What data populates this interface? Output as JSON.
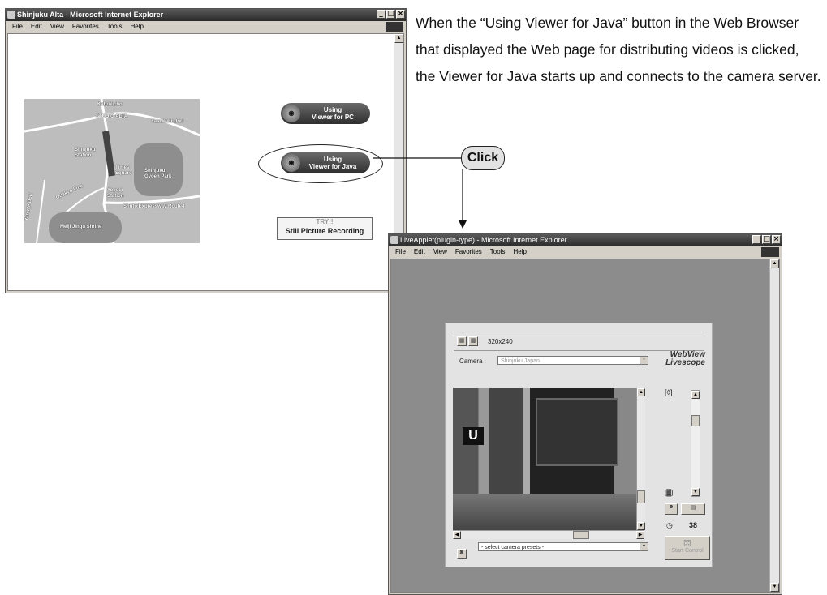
{
  "top_window": {
    "title": "Shinjuku Alta - Microsoft Internet Explorer",
    "menu": [
      "File",
      "Edit",
      "View",
      "Favorites",
      "Tools",
      "Help"
    ],
    "map_labels": {
      "kabukicho": "Kabukicho",
      "studio_alta": "STUDIO ALTA",
      "yasukuni": "Yasukuni Dori",
      "shinjuku_station": "Shinjuku Station",
      "times_square": "Times Square",
      "shinjuku_gyoen": "Shinjuku Gyoen Park",
      "odakyu": "Odakyu Line",
      "yoyogi": "Yoyogi Station",
      "yamate": "Yamate Dori",
      "shuto": "Shuto Expressway Route4",
      "meiji": "Meiji Jingu Shrine"
    },
    "btn_pc": {
      "line1": "Using",
      "line2": "Viewer for PC"
    },
    "btn_java": {
      "line1": "Using",
      "line2": "Viewer for Java"
    },
    "btn_still": {
      "badge": "TRY!!",
      "label": "Still Picture Recording"
    }
  },
  "description": "When the “Using Viewer for Java” button in the Web Browser that displayed the Web page for distributing videos is clicked, the Viewer for Java starts up and connects to the camera server.",
  "callout": "Click",
  "bottom_window": {
    "title": "LiveApplet(plugin-type) - Microsoft Internet Explorer",
    "menu": [
      "File",
      "Edit",
      "View",
      "Favorites",
      "Tools",
      "Help"
    ],
    "applet": {
      "resolution": "320x240",
      "camera_label": "Camera :",
      "camera_value": "Shinjuku,Japan",
      "brand_line1": "WebView",
      "brand_line2": "Livescope",
      "preset_placeholder": "- select camera presets -",
      "start_control": "Start Control",
      "timer_value": "38"
    }
  },
  "colors": {
    "page_bg": "#ffffff",
    "browser_bg": "#8c8c8c"
  }
}
